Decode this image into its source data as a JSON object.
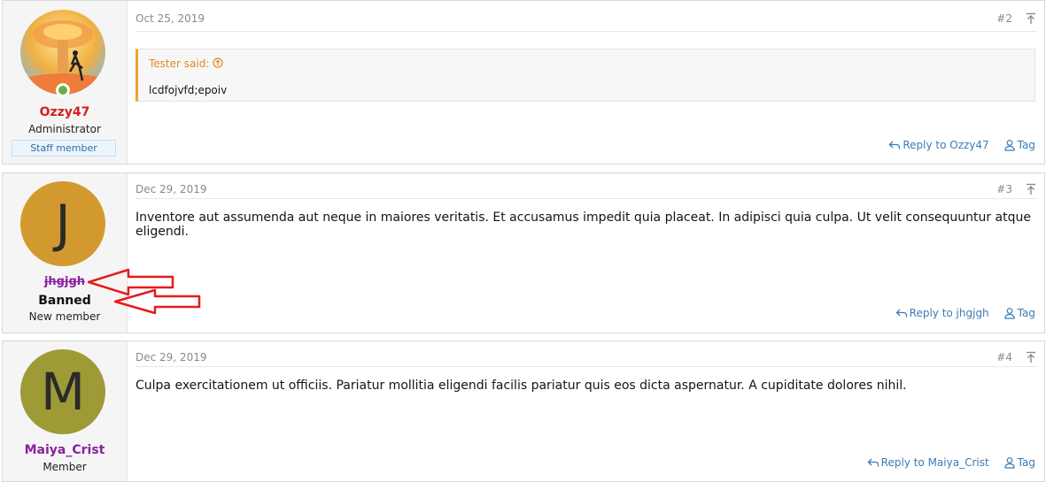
{
  "posts": [
    {
      "date": "Oct 25, 2019",
      "number": "#2",
      "username": "Ozzy47",
      "user_title": "Administrator",
      "badge": "Staff member",
      "quote": {
        "author": "Tester said:",
        "body": "lcdfojvfd;epoiv"
      },
      "reply_label": "Reply to Ozzy47",
      "tag_label": "Tag"
    },
    {
      "date": "Dec 29, 2019",
      "number": "#3",
      "avatar_letter": "J",
      "username": "jhgjgh",
      "status": "Banned",
      "user_title": "New member",
      "body": "Inventore aut assumenda aut neque in maiores veritatis. Et accusamus impedit quia placeat. In adipisci quia culpa. Ut velit consequuntur atque eligendi.",
      "reply_label": "Reply to jhgjgh",
      "tag_label": "Tag"
    },
    {
      "date": "Dec 29, 2019",
      "number": "#4",
      "avatar_letter": "M",
      "username": "Maiya_Crist",
      "user_title": "Member",
      "body": "Culpa exercitationem ut officiis. Pariatur mollitia eligendi facilis pariatur quis eos dicta aspernatur. A cupiditate dolores nihil.",
      "reply_label": "Reply to Maiya_Crist",
      "tag_label": "Tag"
    }
  ],
  "colors": {
    "admin_name": "#d61f1f",
    "banned_name": "#8a1fa0",
    "member_name": "#8a1fa0",
    "avatar_j": "#d29a2e",
    "avatar_m": "#9e9a36",
    "link": "#3d7ab5",
    "annotation_arrow": "#e51b1b"
  },
  "icons": [
    "reply-icon",
    "tag-user-icon",
    "jump-to-top-icon",
    "quote-up-icon"
  ]
}
